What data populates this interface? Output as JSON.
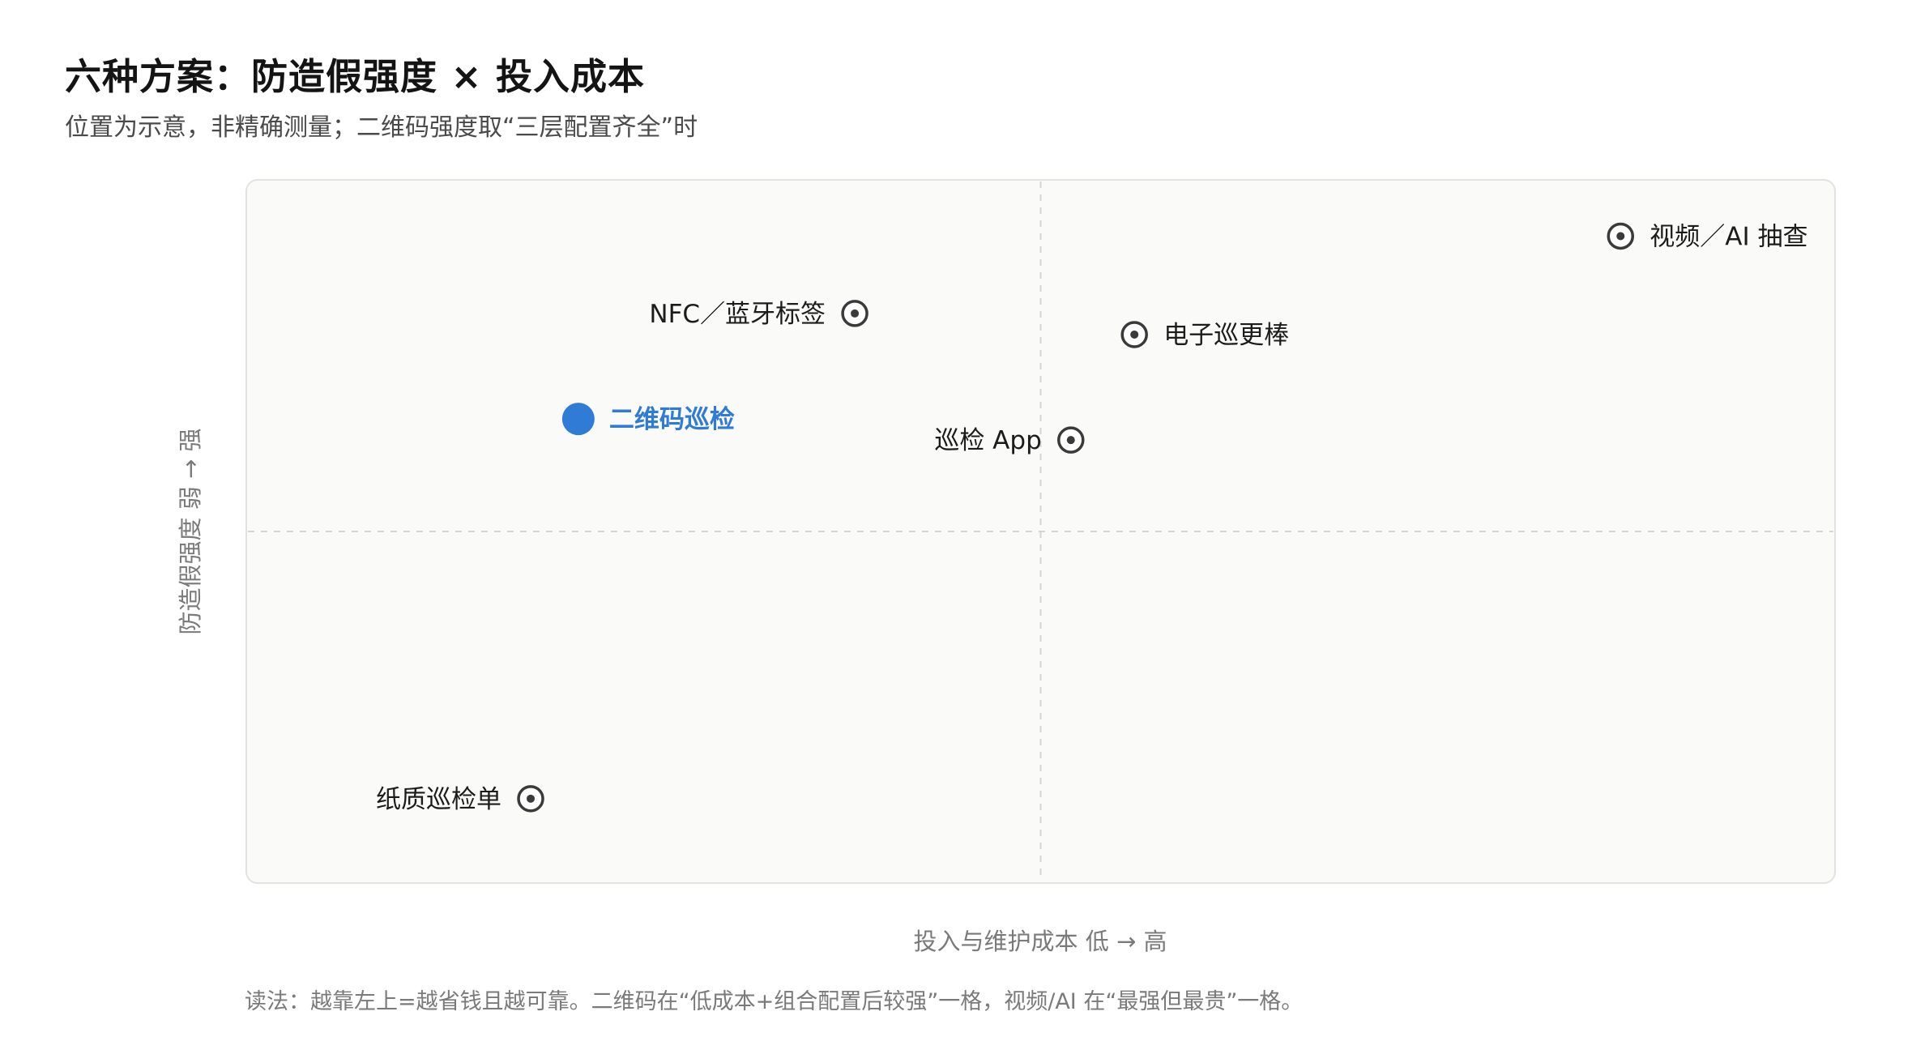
{
  "title": "六种方案：防造假强度 × 投入成本",
  "subtitle": "位置为示意，非精确测量；二维码强度取“三层配置齐全”时",
  "footnote": "读法：越靠左上=越省钱且越可靠。二维码在“低成本+组合配置后较强”一格，视频/AI 在“最强但最贵”一格。",
  "colors": {
    "highlight": "#2f7bd6",
    "marker": "#3a3a3a",
    "plot_bg": "#fafaf8",
    "plot_border": "#e2e2de",
    "divider": "#d4d4d0"
  },
  "chart_data": {
    "type": "scatter",
    "xlabel": "投入与维护成本 低 → 高",
    "ylabel": "防造假强度 弱 → 强",
    "xlim": [
      0,
      100
    ],
    "ylim": [
      0,
      100
    ],
    "grid": false,
    "quadrant_dividers": {
      "x": 50,
      "y": 50
    },
    "points": [
      {
        "label": "视频／AI 抽查",
        "x": 86.5,
        "y": 92,
        "label_side": "right",
        "highlight": false,
        "marker": "ring-dot-icon"
      },
      {
        "label": "NFC／蓝牙标签",
        "x": 38.3,
        "y": 81,
        "label_side": "left",
        "highlight": false,
        "marker": "ring-dot-icon"
      },
      {
        "label": "电子巡更棒",
        "x": 55.9,
        "y": 78,
        "label_side": "right",
        "highlight": false,
        "marker": "ring-dot-icon"
      },
      {
        "label": "二维码巡检",
        "x": 20.9,
        "y": 66,
        "label_side": "right",
        "highlight": true,
        "marker": "filled-circle-icon"
      },
      {
        "label": "巡检 App",
        "x": 51.9,
        "y": 63,
        "label_side": "left",
        "highlight": false,
        "marker": "ring-dot-icon"
      },
      {
        "label": "纸质巡检单",
        "x": 17.9,
        "y": 12,
        "label_side": "left",
        "highlight": false,
        "marker": "ring-dot-icon"
      }
    ]
  }
}
